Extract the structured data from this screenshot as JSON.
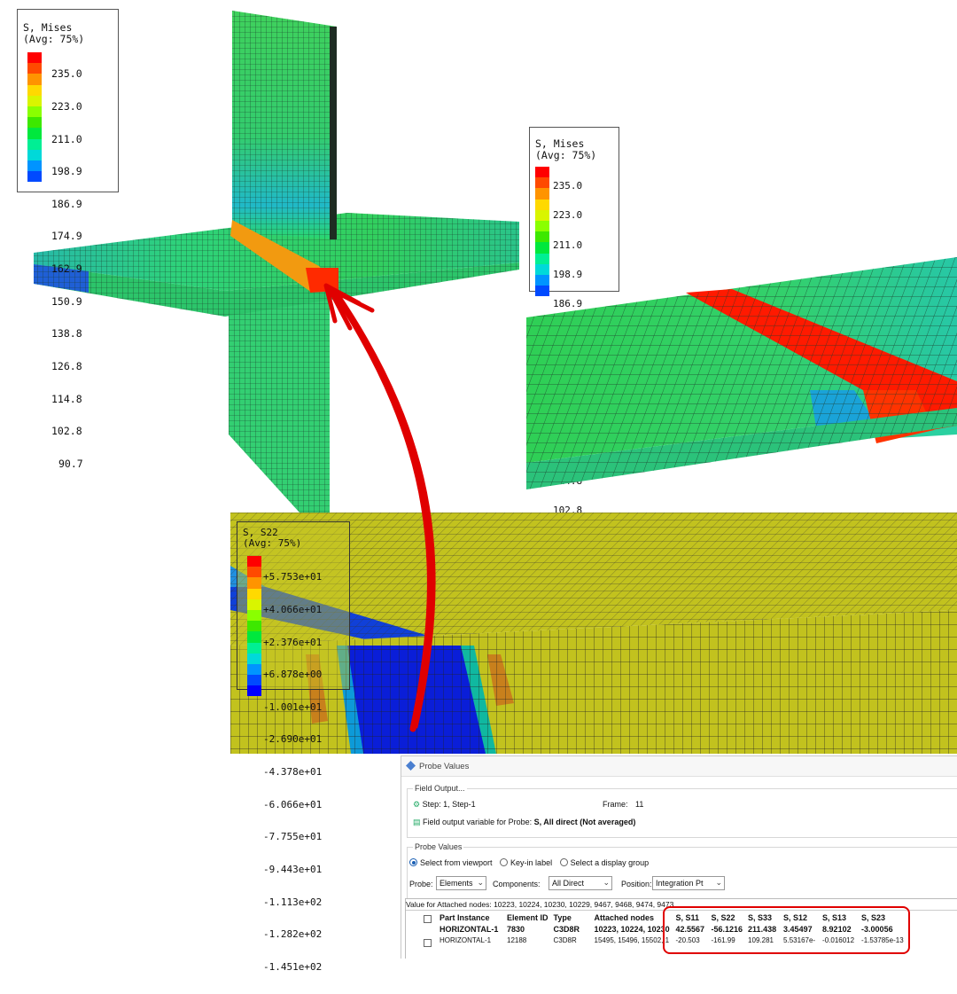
{
  "legend_mises": {
    "title_line1": "S, Mises",
    "title_line2": "(Avg: 75%)",
    "values": [
      "235.0",
      "223.0",
      "211.0",
      "198.9",
      "186.9",
      "174.9",
      "162.9",
      "150.9",
      "138.8",
      "126.8",
      "114.8",
      "102.8",
      "90.7"
    ],
    "colors": [
      "#ff0000",
      "#ff4a00",
      "#ff9400",
      "#ffd900",
      "#d9f500",
      "#8aff00",
      "#3de800",
      "#00e83d",
      "#00ef94",
      "#00d9d9",
      "#0094ff",
      "#004aff",
      "#0000ff"
    ]
  },
  "legend_s22": {
    "title_line1": "S, S22",
    "title_line2": "(Avg: 75%)",
    "values": [
      "+5.753e+01",
      "+4.066e+01",
      "+2.376e+01",
      "+6.878e+00",
      "-1.001e+01",
      "-2.690e+01",
      "-4.378e+01",
      "-6.066e+01",
      "-7.755e+01",
      "-9.443e+01",
      "-1.113e+02",
      "-1.282e+02",
      "-1.451e+02"
    ]
  },
  "probe": {
    "window_title": "Probe Values",
    "field_output_label": "Field Output...",
    "step_label": "Step:",
    "step_value": "1, Step-1",
    "frame_label": "Frame:",
    "frame_value": "11",
    "field_var_label": "Field output variable for Probe:",
    "field_var_value": "S, All direct (Not averaged)",
    "probe_values_label": "Probe Values",
    "radio_options": [
      "Select from viewport",
      "Key-in label",
      "Select a display group"
    ],
    "probe_label": "Probe:",
    "probe_value": "Elements",
    "components_label": "Components:",
    "components_value": "All Direct",
    "position_label": "Position:",
    "position_value": "Integration Pt",
    "attached_nodes_text": "Value for Attached nodes:  10223, 10224, 10230, 10229, 9467, 9468, 9474, 9473",
    "columns": [
      "Part Instance",
      "Element ID",
      "Type",
      "Attached nodes",
      "S, S11",
      "S, S22",
      "S, S33",
      "S, S12",
      "S, S13",
      "S, S23"
    ],
    "rows": [
      [
        "HORIZONTAL-1",
        "7830",
        "C3D8R",
        "10223, 10224, 10230",
        "42.5567",
        "-56.1216",
        "211.438",
        "3.45497",
        "8.92102",
        "-3.00056"
      ],
      [
        "HORIZONTAL-1",
        "12188",
        "C3D8R",
        "15495, 15496, 15502, 1",
        "-20.503",
        "-161.99",
        "109.281",
        "5.53167e-",
        "-0.016012",
        "-1.53785e-13"
      ]
    ]
  },
  "colors": {
    "highlight": "#e00000",
    "arrow": "#e00000",
    "mesh_green": "#2fcf6a",
    "mesh_yellow": "#c3c41e"
  }
}
